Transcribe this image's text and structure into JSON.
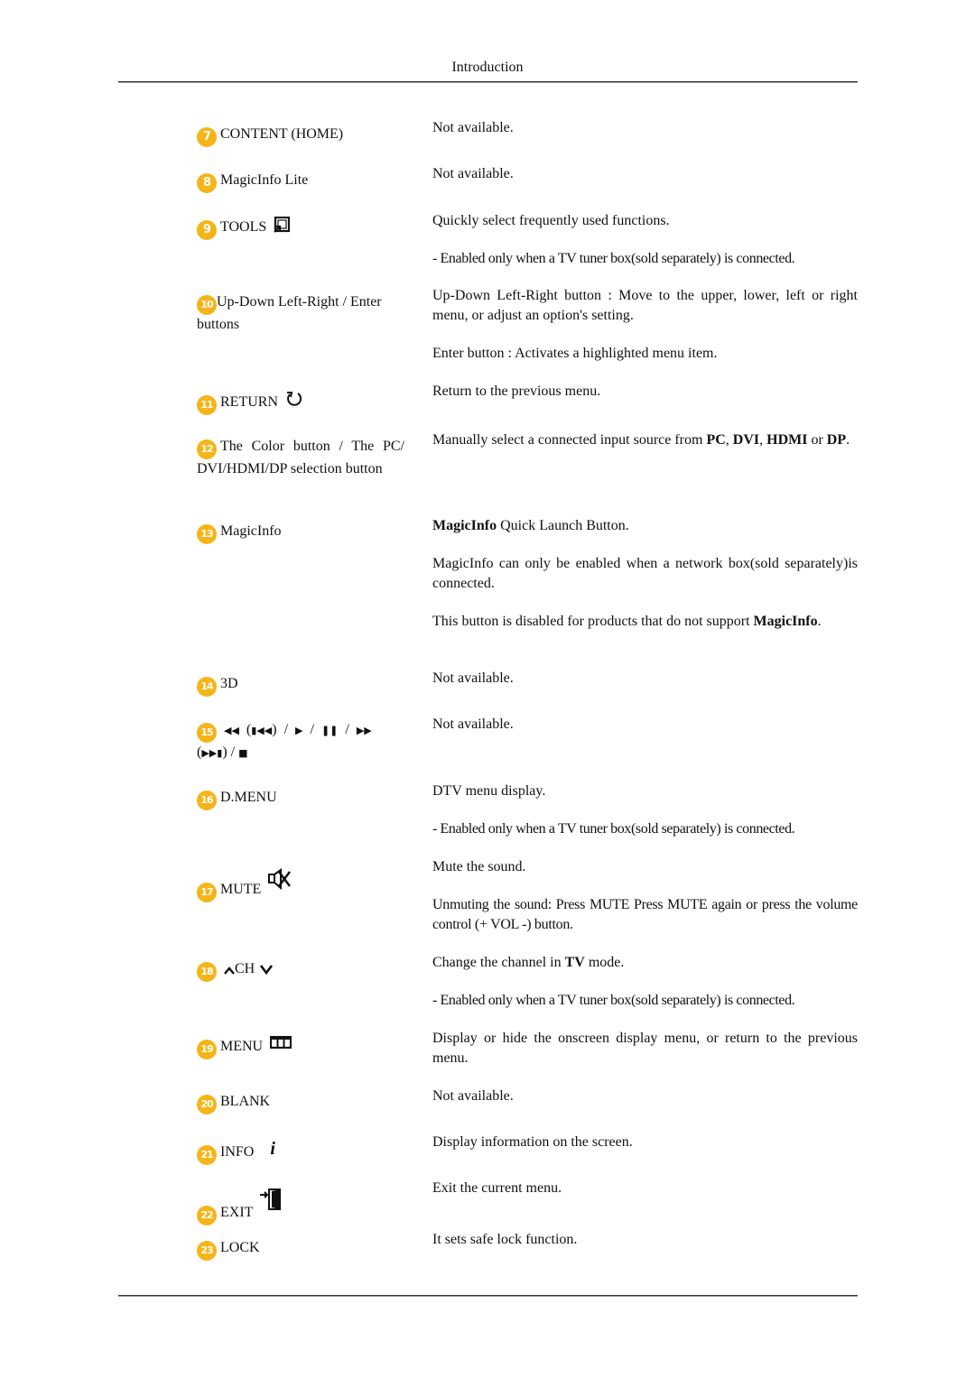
{
  "header": {
    "title": "Introduction"
  },
  "colors": {
    "badge": "#f5b518",
    "rule": "#333333"
  },
  "items": [
    {
      "num": "7",
      "label": "CONTENT (HOME)",
      "icon": null,
      "desc": [
        "Not available."
      ]
    },
    {
      "num": "8",
      "label": "MagicInfo Lite",
      "icon": null,
      "desc": [
        "Not available."
      ]
    },
    {
      "num": "9",
      "label": "TOOLS",
      "icon": "tools-icon",
      "desc": [
        "Quickly select frequently used functions.",
        "- Enabled only when a TV tuner box(sold separately) is connected."
      ]
    },
    {
      "num": "10",
      "label": "Up-Down Left-Right / Enter buttons",
      "icon": null,
      "desc": [
        "Up-Down Left-Right button : Move to the upper, lower, left or right menu, or adjust an option's setting.",
        "Enter button : Activates a highlighted menu item."
      ]
    },
    {
      "num": "11",
      "label": "RETURN",
      "icon": "return-icon",
      "desc": [
        "Return to the previous menu."
      ]
    },
    {
      "num": "12",
      "label": "The Color button / The PC/ DVI/HDMI/DP selection button",
      "icon": null,
      "desc_rich": {
        "prefix": "Manually select a connected input source from ",
        "b1": "PC",
        "s1": ", ",
        "b2": "DVI",
        "s2": ", ",
        "b3": "HDMI",
        "s3": " or ",
        "b4": "DP",
        "s4": "."
      }
    },
    {
      "num": "13",
      "label": "MagicInfo",
      "icon": null,
      "desc_rich": {
        "b0": "MagicInfo",
        "p1": " Quick Launch Button.",
        "p2": "MagicInfo can only be enabled when a network box(sold separately)is connected.",
        "p3": "This button is disabled for products that do not support ",
        "b3": "MagicInfo",
        "p3end": "."
      }
    },
    {
      "num": "14",
      "label": "3D",
      "icon": null,
      "desc": [
        "Not available."
      ]
    },
    {
      "num": "15",
      "label_symbols": [
        "rewind",
        "(",
        "skip-back",
        ")",
        "/",
        "play",
        "/",
        "pause",
        "/",
        "fast-forward",
        "(",
        "skip-forward",
        ")",
        "/",
        "stop"
      ],
      "desc": [
        "Not available."
      ]
    },
    {
      "num": "16",
      "label": "D.MENU",
      "icon": null,
      "desc": [
        "DTV menu display.",
        "- Enabled only when a TV tuner box(sold separately) is connected."
      ]
    },
    {
      "num": "17",
      "label": "MUTE",
      "icon": "mute-icon",
      "desc": [
        "Mute the sound.",
        "Unmuting the sound: Press MUTE Press MUTE again or press the volume control (+ VOL -) button."
      ]
    },
    {
      "num": "18",
      "label": "CH",
      "icon": "channel-up-down-icon",
      "desc_rich": {
        "p1": "Change the channel in ",
        "b1": "TV",
        "p1end": " mode.",
        "p2": "- Enabled only when a TV tuner box(sold separately) is connected."
      }
    },
    {
      "num": "19",
      "label": "MENU",
      "icon": "menu-icon",
      "desc": [
        "Display or hide the onscreen display menu, or return to the previous menu."
      ]
    },
    {
      "num": "20",
      "label": "BLANK",
      "icon": null,
      "desc": [
        "Not available."
      ]
    },
    {
      "num": "21",
      "label": "INFO",
      "icon": "info-icon",
      "desc": [
        "Display information on the screen."
      ]
    },
    {
      "num": "22",
      "label": "EXIT",
      "icon": "exit-icon",
      "desc": [
        "Exit the current menu."
      ]
    },
    {
      "num": "23",
      "label": "LOCK",
      "icon": null,
      "desc": [
        "It sets safe lock function."
      ]
    }
  ]
}
